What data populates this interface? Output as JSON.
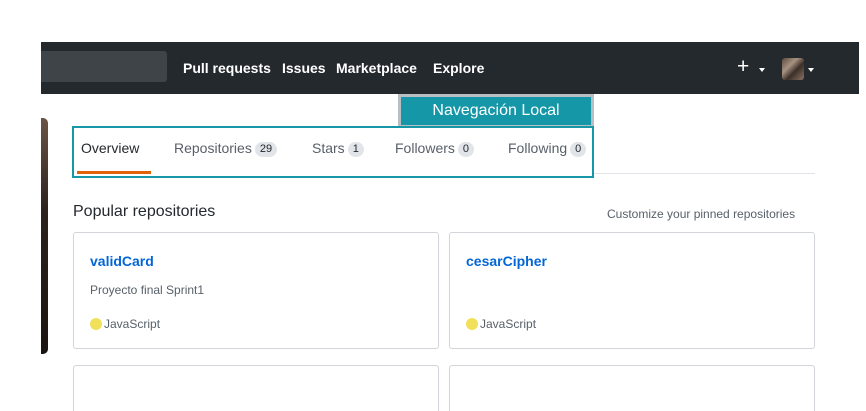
{
  "header": {
    "nav": [
      "Pull requests",
      "Issues",
      "Marketplace",
      "Explore"
    ],
    "new_icon": "plus-icon",
    "menu_icon": "caret-down-icon",
    "avatar_icon": "user-avatar"
  },
  "tooltip": {
    "label": "Navegación Local",
    "color": "#1597a8"
  },
  "tabs": [
    {
      "label": "Overview",
      "count": null,
      "selected": true
    },
    {
      "label": "Repositories",
      "count": "29",
      "selected": false
    },
    {
      "label": "Stars",
      "count": "1",
      "selected": false
    },
    {
      "label": "Followers",
      "count": "0",
      "selected": false
    },
    {
      "label": "Following",
      "count": "0",
      "selected": false
    }
  ],
  "popular": {
    "title": "Popular repositories",
    "customize": "Customize your pinned repositories"
  },
  "repos": [
    {
      "name": "validCard",
      "description": "Proyecto final Sprint1",
      "language": "JavaScript",
      "language_color": "#f1e05a"
    },
    {
      "name": "cesarCipher",
      "description": "",
      "language": "JavaScript",
      "language_color": "#f1e05a"
    }
  ],
  "colors": {
    "header_bg": "#24292e",
    "link": "#0366d6",
    "tab_selected": "#e36209"
  }
}
